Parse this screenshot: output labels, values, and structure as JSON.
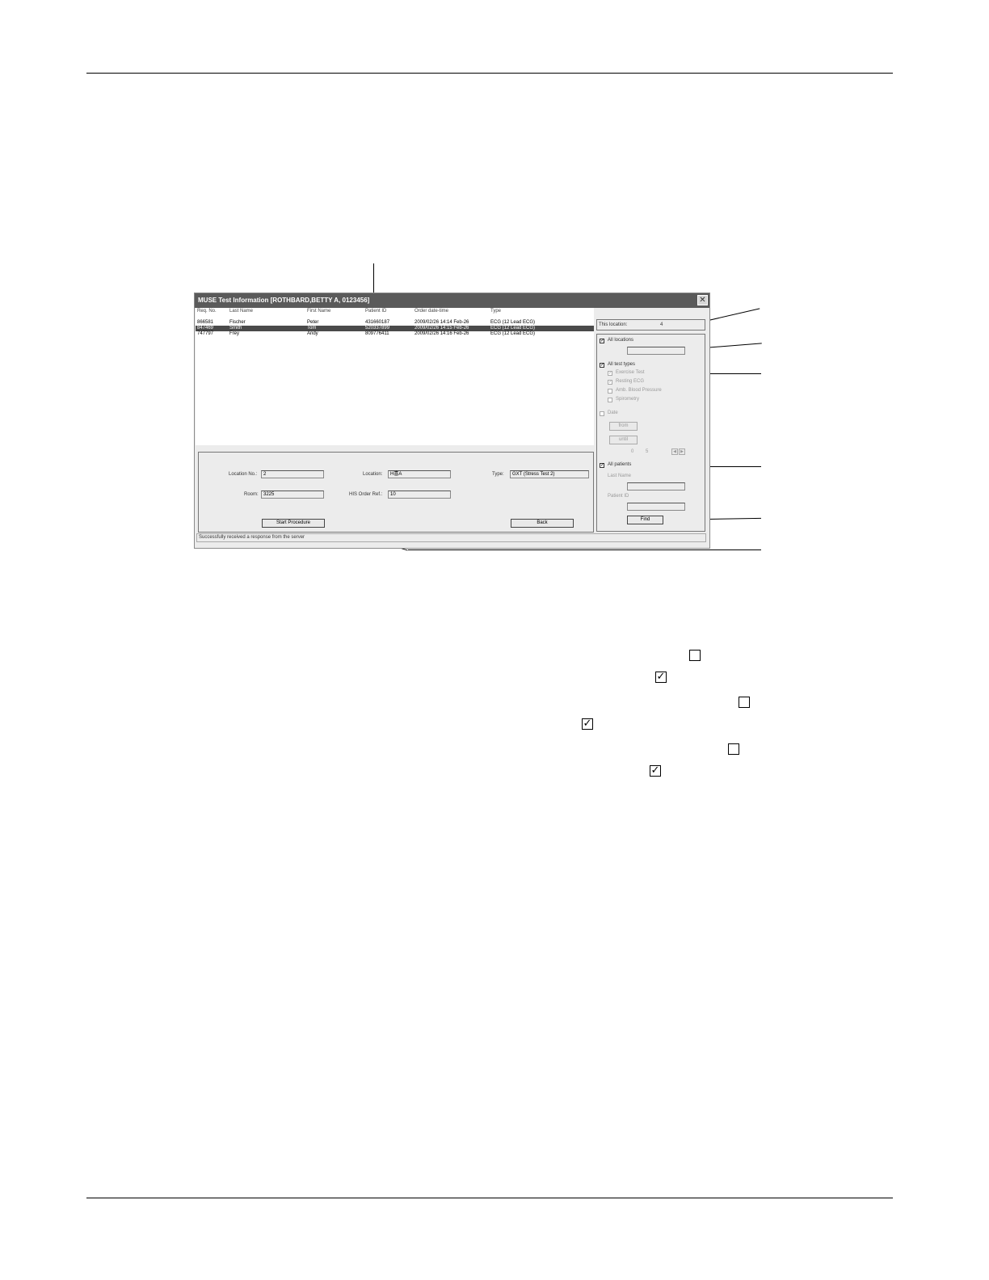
{
  "window": {
    "title": "MUSE Test Information [ROTHBARD,BETTY A, 0123456]",
    "close_icon": "close-icon"
  },
  "list": {
    "columns": [
      "Req. No.",
      "Last Name",
      "First Name",
      "Patient ID",
      "Order date-time",
      "Type"
    ],
    "rows": [
      {
        "req": "866581",
        "last": "Fischer",
        "first": "Peter",
        "pid": "431660187",
        "dt": "2009/02/26   14:14 Feb-26",
        "type": "ECG (12 Lead ECG)"
      },
      {
        "req": "847469",
        "last": "Smith",
        "first": "Tom",
        "pid": "520337899",
        "dt": "2009/02/26   14:15 Feb-26",
        "type": "ECG (12 Lead ECG)"
      },
      {
        "req": "747797",
        "last": "Frey",
        "first": "Andy",
        "pid": "809776411",
        "dt": "2009/02/26   14:16 Feb-26",
        "type": "ECG (12 Lead ECG)"
      }
    ],
    "selected_index": 1
  },
  "details": {
    "location_no_label": "Location No.:",
    "location_no_value": "2",
    "location_label": "Location:",
    "location_value": "H喜A",
    "type_label": "Type:",
    "type_value": "GXT (Stress Test 2)",
    "room_label": "Room:",
    "room_value": "3225",
    "his_label": "HIS Order Ref.:",
    "his_value": "10",
    "start_button": "Start Procedure",
    "back_button": "Back"
  },
  "status": "Successfully received a response from the server",
  "filters": {
    "this_location_label": "This location:",
    "this_location_value": "4",
    "all_locations": "All locations",
    "all_test_types": "All test types",
    "test_types": [
      "Exercise Test",
      "Resting ECG",
      "Amb. Blood Pressure",
      "Spirometry"
    ],
    "date_label": "Date",
    "from_button": "from",
    "until_button": "until",
    "range_from": "0",
    "range_to": "5",
    "all_patients": "All patients",
    "last_name_label": "Last Name",
    "patient_id_label": "Patient ID",
    "find_button": "Find"
  }
}
